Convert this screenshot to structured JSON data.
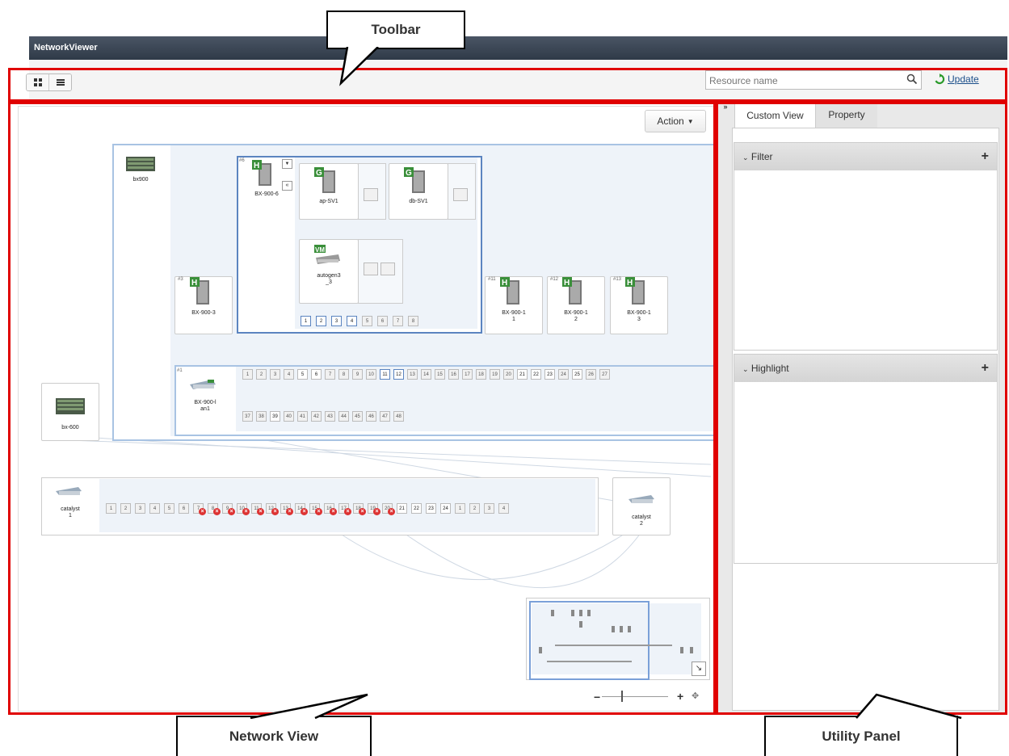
{
  "app": {
    "title": "NetworkViewer"
  },
  "callouts": {
    "toolbar": "Toolbar",
    "network_view": "Network View",
    "utility_panel": "Utility Panel"
  },
  "toolbar": {
    "view_buttons": [
      {
        "icon": "grid-view-icon"
      },
      {
        "icon": "list-view-icon"
      }
    ],
    "search_placeholder": "Resource name",
    "update_label": "Update"
  },
  "network_view": {
    "action_label": "Action",
    "chassis_bx900": {
      "label": "bx900"
    },
    "blade_bx900_6": {
      "slot": "#6",
      "label": "BX-900-6",
      "badge": "H"
    },
    "vm_guests": [
      {
        "label": "ap-SV1",
        "badge": "G"
      },
      {
        "label": "db-SV1",
        "badge": "G"
      }
    ],
    "vswitch": {
      "label": "autogen3\n_3",
      "badge": "VM"
    },
    "blade_ports": [
      "1",
      "2",
      "3",
      "4",
      "5",
      "6",
      "7",
      "8"
    ],
    "blade_bx900_3": {
      "slot": "#3",
      "label": "BX-900-3",
      "badge": "H"
    },
    "blades_right": [
      {
        "slot": "#11",
        "label": "BX-900-1\n1",
        "badge": "H"
      },
      {
        "slot": "#12",
        "label": "BX-900-1\n2",
        "badge": "H"
      },
      {
        "slot": "#13",
        "label": "BX-900-1\n3",
        "badge": "H"
      }
    ],
    "lan_switch": {
      "slot": "#1",
      "label": "BX-900-l\nan1"
    },
    "lan_ports_top": [
      "1",
      "2",
      "3",
      "4",
      "5",
      "6",
      "7",
      "8",
      "9",
      "10",
      "11",
      "12",
      "13",
      "14",
      "15",
      "16",
      "17",
      "18",
      "19",
      "20",
      "21",
      "22",
      "23",
      "24",
      "25",
      "26",
      "27"
    ],
    "lan_ports_bottom": [
      "37",
      "38",
      "39",
      "40",
      "41",
      "42",
      "43",
      "44",
      "45",
      "46",
      "47",
      "48"
    ],
    "chassis_bx600": {
      "label": "bx-600"
    },
    "catalyst1": {
      "label": "catalyst\n1"
    },
    "catalyst1_ports": [
      "1",
      "2",
      "3",
      "4",
      "5",
      "6",
      "7",
      "8",
      "9",
      "10",
      "11",
      "12",
      "13",
      "14",
      "15",
      "16",
      "17",
      "18",
      "19",
      "20",
      "21",
      "22",
      "23",
      "24",
      "1",
      "2",
      "3",
      "4"
    ],
    "catalyst2": {
      "label": "catalyst\n2"
    }
  },
  "utility_panel": {
    "tabs": [
      {
        "label": "Custom View"
      },
      {
        "label": "Property"
      }
    ],
    "filter_label": "Filter",
    "highlight_label": "Highlight"
  }
}
